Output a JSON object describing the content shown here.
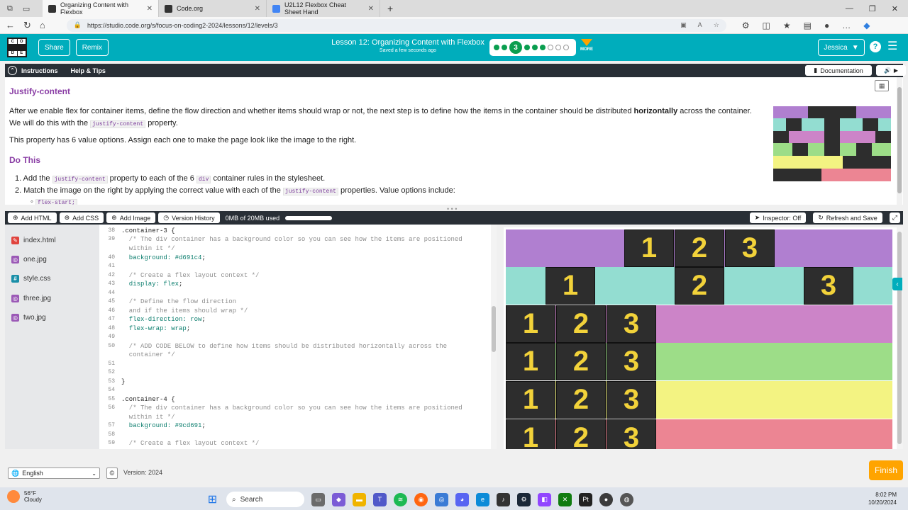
{
  "browser": {
    "tabs": [
      {
        "label": "Organizing Content with Flexbox"
      },
      {
        "label": "Code.org"
      },
      {
        "label": "U2L12 Flexbox Cheat Sheet Hand"
      }
    ],
    "url": "https://studio.code.org/s/focus-on-coding2-2024/lessons/12/levels/3"
  },
  "header": {
    "logo_letters": [
      "C",
      "O",
      "D",
      "E"
    ],
    "share_label": "Share",
    "remix_label": "Remix",
    "lesson_title": "Lesson 12: Organizing Content with Flexbox",
    "save_status": "Saved a few seconds ago",
    "current_level": "3",
    "more_label": "MORE",
    "user_name": "Jessica",
    "help_label": "?"
  },
  "instructions": {
    "tab_instructions": "Instructions",
    "tab_help": "Help & Tips",
    "documentation_label": "Documentation",
    "title": "Justify-content",
    "para1_a": "After we enable flex for container items, define the flow direction and whether items should wrap or not, the next step is to define how the items in the container should be distributed ",
    "para1_bold": "horizontally",
    "para1_b": " across the container. We will do this with the ",
    "para1_code": "justify-content",
    "para1_c": " property.",
    "para2": "This property has 6 value options. Assign each one to make the page look like the image to the right.",
    "do_this": "Do This",
    "step1_a": "Add the ",
    "step1_code1": "justify-content",
    "step1_b": " property to each of the 6 ",
    "step1_code2": "div",
    "step1_c": " container rules in the stylesheet.",
    "step2_a": "Match the image on the right by applying the correct value with each of the ",
    "step2_code": "justify-content",
    "step2_b": " properties. Value options include:",
    "option1": "flex-start;"
  },
  "toolbar": {
    "add_html": "Add HTML",
    "add_css": "Add CSS",
    "add_image": "Add Image",
    "version_history": "Version History",
    "storage": "0MB of 20MB used",
    "inspector": "Inspector: Off",
    "refresh_save": "Refresh and Save"
  },
  "files": [
    {
      "name": "index.html",
      "color": "#e0443e",
      "icon": "pencil-icon"
    },
    {
      "name": "one.jpg",
      "color": "#9b59b6",
      "icon": "image-icon"
    },
    {
      "name": "style.css",
      "color": "#1a8fa8",
      "icon": "hash-icon"
    },
    {
      "name": "three.jpg",
      "color": "#9b59b6",
      "icon": "image-icon"
    },
    {
      "name": "two.jpg",
      "color": "#9b59b6",
      "icon": "image-icon"
    }
  ],
  "code": {
    "line_numbers": [
      "38",
      "39",
      "40",
      "41",
      "42",
      "43",
      "44",
      "45",
      "46",
      "47",
      "48",
      "49",
      "50",
      "51",
      "52",
      "53",
      "54",
      "55",
      "56",
      "57",
      "58",
      "59"
    ],
    "l38": ".container-3 {",
    "l39a": "  /* The div container has a background color so you can see how the items are positioned",
    "l39b": "  within it */",
    "l40_prop": "  background: ",
    "l40_val": "#d691c4",
    "l42": "  /* Create a flex layout context */",
    "l43_prop": "  display: ",
    "l43_val": "flex",
    "l45": "  /* Define the flow direction",
    "l46": "  and if the items should wrap */",
    "l47_prop": "  flex-direction: ",
    "l47_val": "row",
    "l48_prop": "  flex-wrap: ",
    "l48_val": "wrap",
    "l50a": "  /* ADD CODE BELOW to define how items should be distributed horizontally across the",
    "l50b": "  container */",
    "l53": "}",
    "l55": ".container-4 {",
    "l56a": "  /* The div container has a background color so you can see how the items are positioned",
    "l56b": "  within it */",
    "l57_prop": "  background: ",
    "l57_val": "#9cd691",
    "l59": "  /* Create a flex layout context */"
  },
  "preview": {
    "rows": [
      {
        "bg": "#b07fd0",
        "items": [
          "1",
          "2",
          "3"
        ]
      },
      {
        "bg": "#93ddd1",
        "items": [
          "1",
          "2",
          "3"
        ]
      },
      {
        "bg": "#cc84c8",
        "items": [
          "1",
          "2",
          "3"
        ]
      },
      {
        "bg": "#9ddd88",
        "items": [
          "1",
          "2",
          "3"
        ]
      },
      {
        "bg": "#f3f382",
        "items": [
          "1",
          "2",
          "3"
        ]
      },
      {
        "bg": "#ec8593",
        "items": [
          "1",
          "2",
          "3"
        ]
      }
    ]
  },
  "footer": {
    "language": "English",
    "copyright": "©",
    "version": "Version: 2024",
    "finish": "Finish"
  },
  "taskbar": {
    "temp": "56°F",
    "condition": "Cloudy",
    "search": "Search",
    "time": "8:02 PM",
    "date": "10/20/2024"
  }
}
